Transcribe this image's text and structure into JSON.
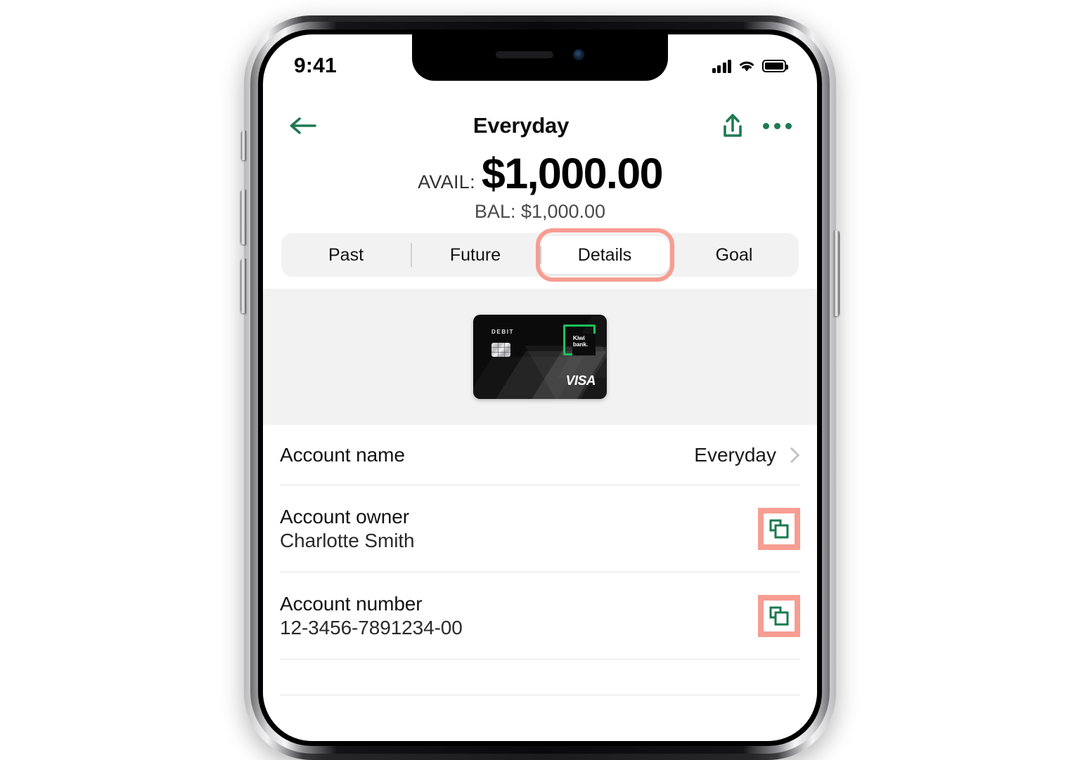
{
  "device": {
    "type": "iphone-mockup",
    "side_buttons": [
      "mute-switch",
      "volume-up",
      "volume-down",
      "power"
    ]
  },
  "status_bar": {
    "time": "9:41",
    "cellular_icon": "cellular-bars-icon",
    "cellular_bars": 4,
    "wifi_icon": "wifi-icon",
    "battery_icon": "battery-full-icon"
  },
  "header": {
    "back_icon": "arrow-left-icon",
    "title": "Everyday",
    "share_icon": "share-icon",
    "more_icon": "more-horizontal-icon"
  },
  "balance": {
    "available_label": "AVAIL:",
    "available_amount": "$1,000.00",
    "balance_line": "BAL: $1,000.00"
  },
  "tabs": {
    "items": [
      {
        "label": "Past",
        "active": false
      },
      {
        "label": "Future",
        "active": false
      },
      {
        "label": "Details",
        "active": true
      },
      {
        "label": "Goal",
        "active": false
      }
    ],
    "highlight_color": "#f79d92",
    "active_index": 2
  },
  "card": {
    "type_label": "DEBIT",
    "brand_line1": "Kiwi",
    "brand_line2": "bank.",
    "network": "VISA",
    "chip_icon": "emv-chip-icon",
    "background_color": "#0b0b0b",
    "logo_color": "#19c25c"
  },
  "details": {
    "rows": [
      {
        "label": "Account name",
        "value": "Everyday",
        "sub": "",
        "action": "chevron",
        "action_icon": "chevron-right-icon"
      },
      {
        "label": "Account owner",
        "value": "",
        "sub": "Charlotte Smith",
        "action": "copy",
        "action_icon": "copy-icon"
      },
      {
        "label": "Account number",
        "value": "",
        "sub": "12-3456-7891234-00",
        "action": "copy",
        "action_icon": "copy-icon"
      }
    ]
  },
  "colors": {
    "brand_green": "#1e7a52",
    "highlight_salmon": "#f79d92",
    "panel_gray": "#f2f2f2",
    "divider": "#e3e3e3"
  }
}
